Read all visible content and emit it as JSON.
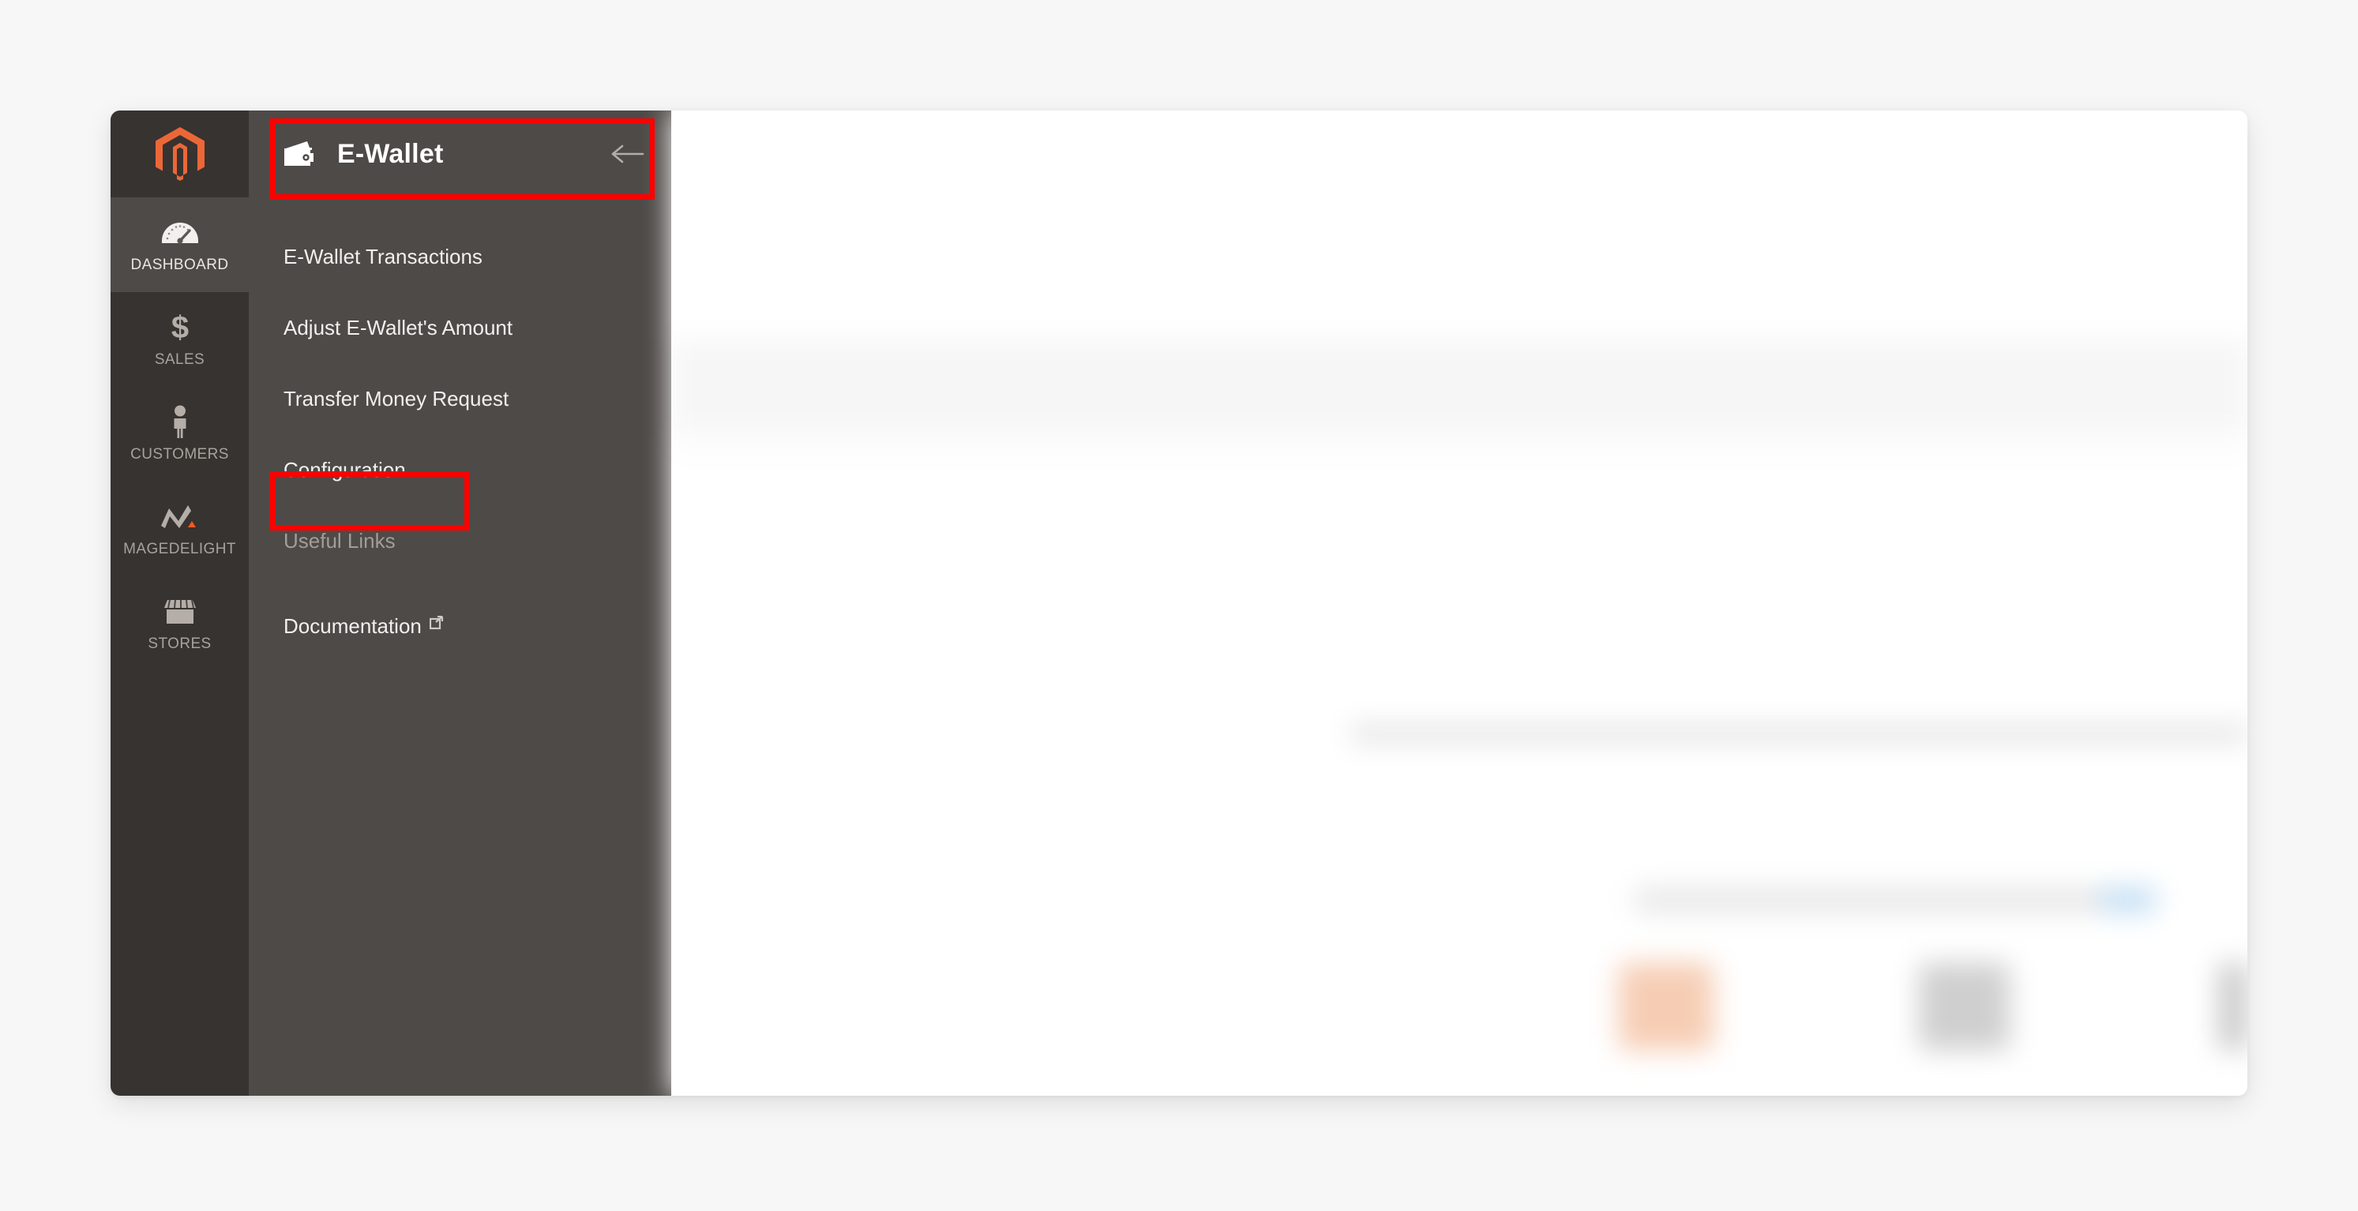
{
  "page": {
    "background_color": "#f7f7f7"
  },
  "primary_nav": {
    "logo": {
      "icon": "magento-logo-icon",
      "color": "#ec6737"
    },
    "items": [
      {
        "label": "Dashboard",
        "icon": "gauge-icon",
        "active": true
      },
      {
        "label": "Sales",
        "icon": "dollar-sign-icon",
        "active": false
      },
      {
        "label": "Customers",
        "icon": "person-icon",
        "active": false
      },
      {
        "label": "Magedelight",
        "icon": "magedelight-icon",
        "active": false
      },
      {
        "label": "Stores",
        "icon": "storefront-icon",
        "active": false
      }
    ]
  },
  "submenu": {
    "title": "E-Wallet",
    "title_icon": "wallet-icon",
    "back_icon": "arrow-left-icon",
    "items": [
      {
        "label": "E-Wallet Transactions",
        "type": "link"
      },
      {
        "label": "Adjust E-Wallet's Amount",
        "type": "link"
      },
      {
        "label": "Transfer Money Request",
        "type": "link"
      },
      {
        "label": "Configuration",
        "type": "link"
      },
      {
        "label": "Useful Links",
        "type": "section-title"
      },
      {
        "label": "Documentation",
        "type": "external-link",
        "icon": "external-link-icon"
      }
    ]
  },
  "annotations": {
    "highlight_color": "#ff0000",
    "boxes": [
      {
        "target": "E-Wallet",
        "name": "submenu-header-highlight"
      },
      {
        "target": "Configuration",
        "name": "configuration-item-highlight"
      }
    ]
  },
  "content": {
    "blurred": true,
    "colors": {
      "primary_button": "#eb5a1e",
      "secondary_button": "#1979c3",
      "side_tab": "#f58020",
      "notification_badge": "#e04f4f"
    }
  }
}
